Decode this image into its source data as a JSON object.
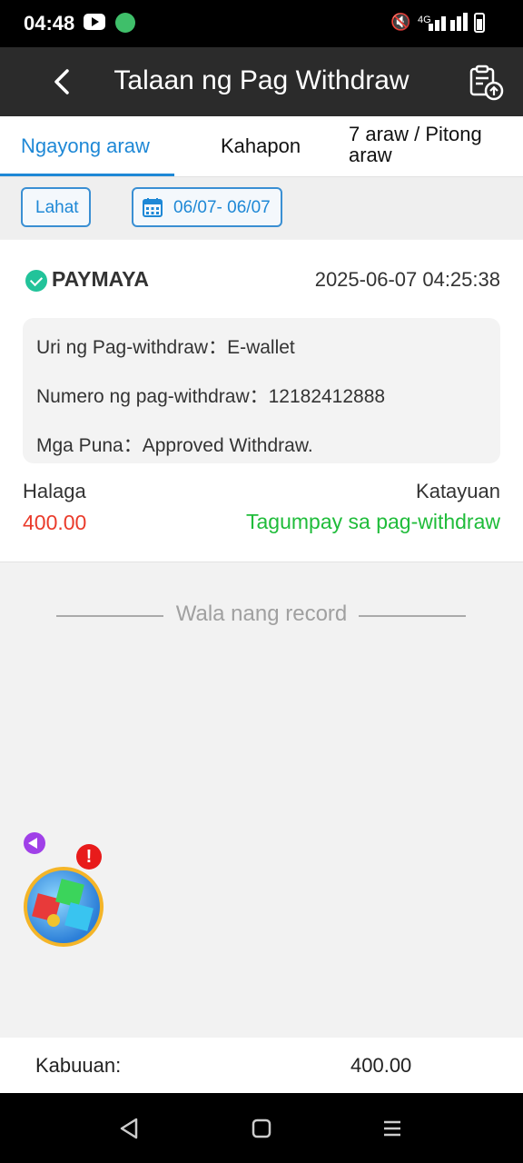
{
  "status_bar": {
    "time": "04:48",
    "network": "4G"
  },
  "header": {
    "title": "Talaan ng Pag Withdraw",
    "back_icon": "chevron-left-icon",
    "action_icon": "clipboard-upload-icon"
  },
  "tabs": [
    {
      "label": "Ngayong araw",
      "active": true
    },
    {
      "label": "Kahapon",
      "active": false
    },
    {
      "label": "7 araw / Pitong\naraw",
      "active": false
    }
  ],
  "filters": {
    "all_label": "Lahat",
    "date_range": "06/07- 06/07"
  },
  "record": {
    "method": "PAYMAYA",
    "datetime": "2025-06-07 04:25:38",
    "type_label": "Uri ng Pag-withdraw：",
    "type_value": "E-wallet",
    "number_label": "Numero ng pag-withdraw：",
    "number_value": "12182412888",
    "remarks_label": "Mga Puna：",
    "remarks_value": "Approved Withdraw.",
    "amount_label": "Halaga",
    "amount_value": "400.00",
    "status_label": "Katayuan",
    "status_value": "Tagumpay sa pag-withdraw"
  },
  "no_more_records": "Wala nang record",
  "total": {
    "label": "Kabuuan:",
    "value": "400.00"
  },
  "colors": {
    "accent": "#1e88d6",
    "amount": "#ea3b2b",
    "success": "#1fbc3a",
    "header_bg": "#2b2b2b"
  }
}
